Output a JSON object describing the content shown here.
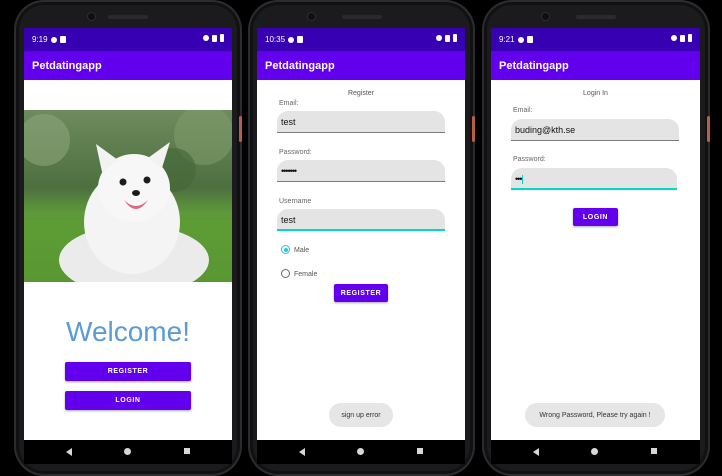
{
  "colors": {
    "status_bar": "#3700b3",
    "app_bar": "#6200ee",
    "button": "#6200ee",
    "focus_accent": "#03dac5",
    "welcome_text": "#5b9bd5"
  },
  "phones": [
    {
      "status": {
        "time": "9:19"
      },
      "app_bar": {
        "title": "Petdatingapp"
      },
      "photo": {
        "subject": "white fluffy dog on grass"
      },
      "welcome": {
        "text": "Welcome!"
      },
      "buttons": {
        "register": "REGISTER",
        "login": "LOGIN"
      }
    },
    {
      "status": {
        "time": "10:35"
      },
      "app_bar": {
        "title": "Petdatingapp"
      },
      "form": {
        "heading": "Register",
        "email_label": "Email:",
        "email_value": "test",
        "password_label": "Password:",
        "password_value": "•••••••",
        "username_label": "Username",
        "username_value": "test",
        "gender_options": [
          "Male",
          "Female"
        ],
        "selected_gender": "Male",
        "submit": "REGISTER"
      },
      "toast": {
        "text": "sign up error"
      }
    },
    {
      "status": {
        "time": "9:21"
      },
      "app_bar": {
        "title": "Petdatingapp"
      },
      "form": {
        "heading": "Login In",
        "email_label": "Email:",
        "email_value": "buding@kth.se",
        "password_label": "Password:",
        "password_value": "•••",
        "submit": "LOGIN"
      },
      "toast": {
        "text": "Wrong Password, Please try again !"
      }
    }
  ]
}
